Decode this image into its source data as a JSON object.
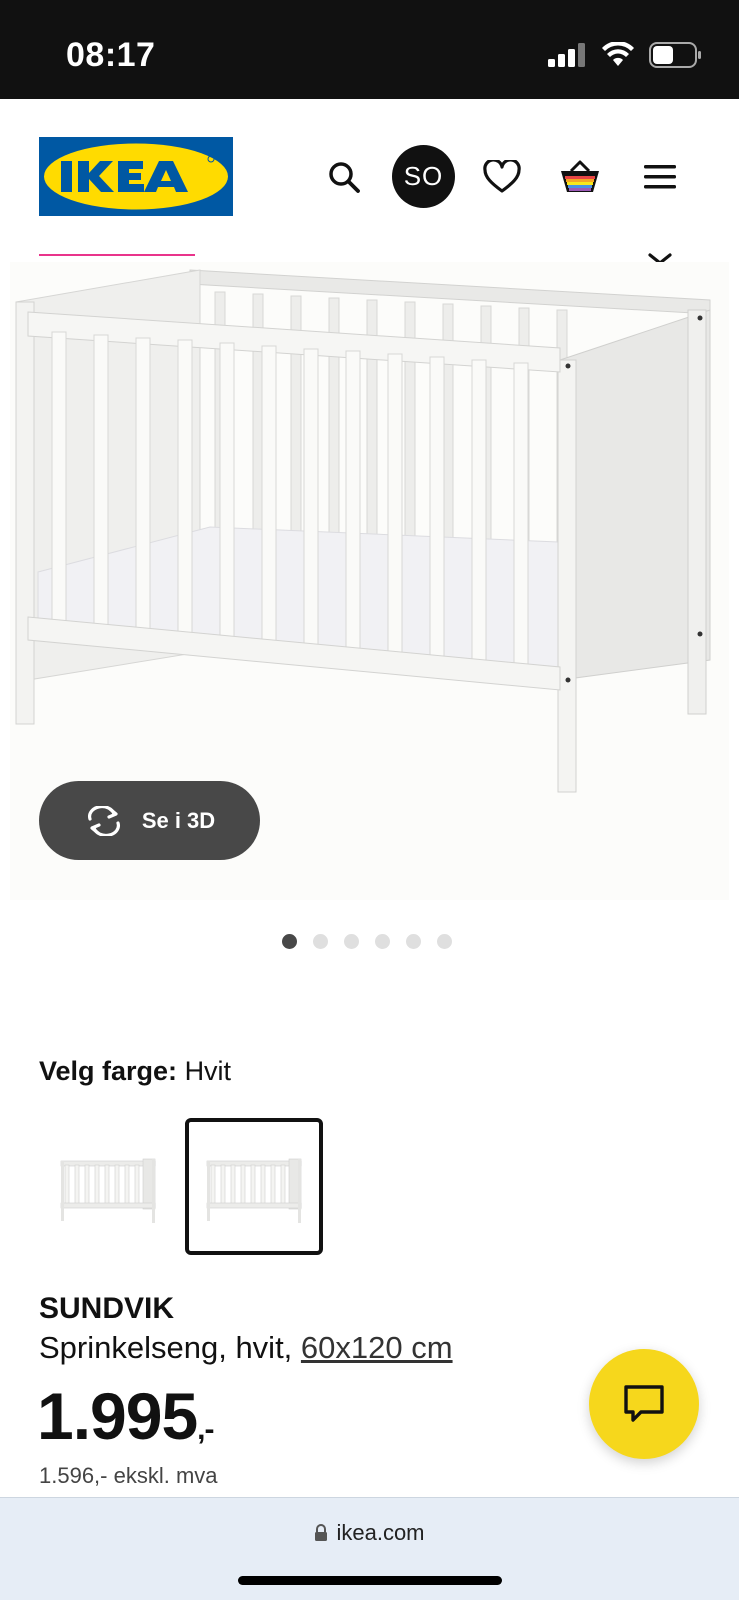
{
  "status_bar": {
    "time": "08:17"
  },
  "header": {
    "logo_text": "IKEA",
    "avatar_initials": "SO"
  },
  "product_image": {
    "button_label": "Se i 3D",
    "dots_total": 6,
    "dots_active_index": 0
  },
  "color": {
    "label": "Velg farge:",
    "value": "Hvit"
  },
  "product": {
    "name": "SUNDVIK",
    "description": "Sprinkelseng, hvit, ",
    "size": "60x120 cm",
    "price": "1.995",
    "price_suffix": ",-",
    "price_ex_vat": "1.596,- ekskl. mva"
  },
  "browser": {
    "url": "ikea.com"
  },
  "colors": {
    "ikea_blue": "#0058a3",
    "ikea_yellow": "#ffdb00",
    "chat_yellow": "#f6d71c",
    "button_dark": "#484848"
  }
}
